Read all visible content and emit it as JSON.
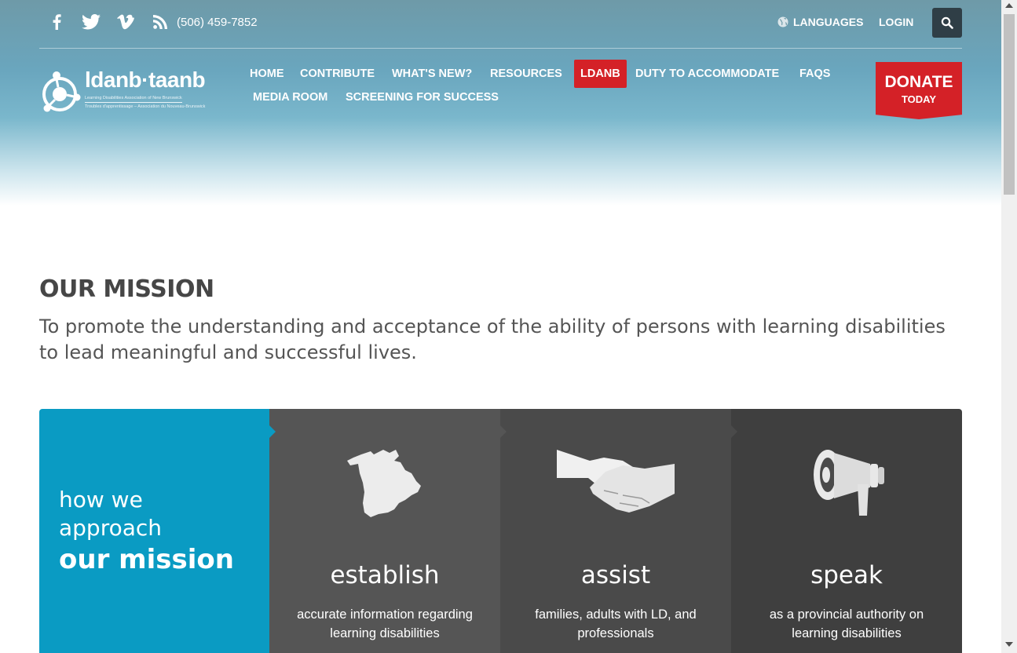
{
  "topbar": {
    "social_icons": [
      "facebook-icon",
      "twitter-icon",
      "vimeo-icon",
      "rss-icon"
    ],
    "phone": "(506) 459-7852",
    "languages_label": "LANGUAGES",
    "login_label": "LOGIN",
    "search_icon": "search-icon"
  },
  "logo": {
    "title": "ldanb·taanb",
    "subtitle_en": "Learning Disabilities Association of New Brunswick",
    "subtitle_fr": "Troubles d'apprentissage – Association du Nouveau-Brunswick"
  },
  "nav": {
    "items": [
      {
        "label": "HOME"
      },
      {
        "label": "CONTRIBUTE"
      },
      {
        "label": "WHAT'S NEW?"
      },
      {
        "label": "RESOURCES"
      },
      {
        "label": "LDANB",
        "active": true
      },
      {
        "label": "DUTY TO ACCOMMODATE"
      },
      {
        "label": "FAQS"
      },
      {
        "label": "MEDIA ROOM"
      },
      {
        "label": "SCREENING FOR SUCCESS"
      }
    ]
  },
  "donate": {
    "big": "DONATE",
    "small": "TODAY"
  },
  "mission": {
    "title": "OUR MISSION",
    "text": "To promote the understanding and acceptance of the ability of persons with learning disabilities to lead meaningful and successful lives."
  },
  "approach": {
    "line1": "how we",
    "line2": "approach",
    "bold": "our mission"
  },
  "panels": [
    {
      "icon": "new-brunswick-map-icon",
      "heading": "establish",
      "text": "accurate information regarding learning disabilities"
    },
    {
      "icon": "handshake-icon",
      "heading": "assist",
      "text": "families, adults with LD, and professionals"
    },
    {
      "icon": "megaphone-icon",
      "heading": "speak",
      "text": "as a provincial authority on learning disabilities"
    }
  ],
  "colors": {
    "accent_red": "#d42127",
    "panel_blue": "#0a9bc3",
    "search_bg": "#2f3e46"
  }
}
